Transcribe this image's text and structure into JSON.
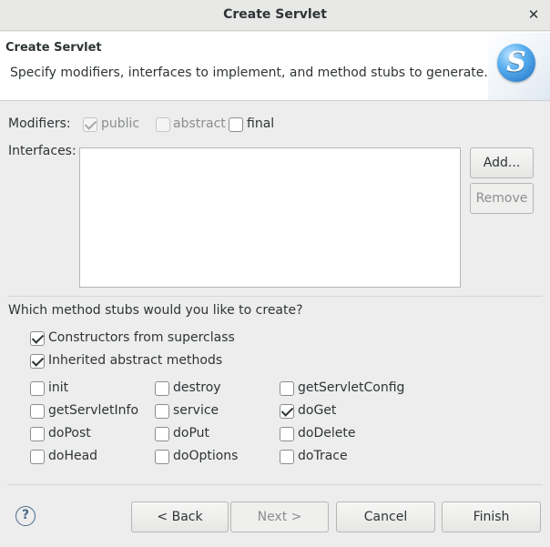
{
  "window": {
    "title": "Create Servlet",
    "close_glyph": "✕"
  },
  "header": {
    "title": "Create Servlet",
    "description": "Specify modifiers, interfaces to implement, and method stubs to generate.",
    "logo_letter": "S",
    "logo_icon": "servlet-wizard-icon"
  },
  "modifiers": {
    "label": "Modifiers:",
    "public": {
      "label": "public",
      "checked": true,
      "enabled": false
    },
    "abstract": {
      "label": "abstract",
      "checked": false,
      "enabled": false
    },
    "final": {
      "label": "final",
      "checked": false,
      "enabled": true
    }
  },
  "interfaces": {
    "label": "Interfaces:",
    "items": [],
    "add_label": "Add...",
    "remove_label": "Remove"
  },
  "stubs": {
    "question": "Which method stubs would you like to create?",
    "constructors": {
      "label": "Constructors from superclass",
      "checked": true
    },
    "inherited": {
      "label": "Inherited abstract methods",
      "checked": true
    },
    "methods": [
      {
        "label": "init",
        "checked": false
      },
      {
        "label": "destroy",
        "checked": false
      },
      {
        "label": "getServletConfig",
        "checked": false
      },
      {
        "label": "getServletInfo",
        "checked": false
      },
      {
        "label": "service",
        "checked": false
      },
      {
        "label": "doGet",
        "checked": true
      },
      {
        "label": "doPost",
        "checked": false
      },
      {
        "label": "doPut",
        "checked": false
      },
      {
        "label": "doDelete",
        "checked": false
      },
      {
        "label": "doHead",
        "checked": false
      },
      {
        "label": "doOptions",
        "checked": false
      },
      {
        "label": "doTrace",
        "checked": false
      }
    ]
  },
  "footer": {
    "help_glyph": "?",
    "back_label": "< Back",
    "next_label": "Next >",
    "cancel_label": "Cancel",
    "finish_label": "Finish"
  }
}
